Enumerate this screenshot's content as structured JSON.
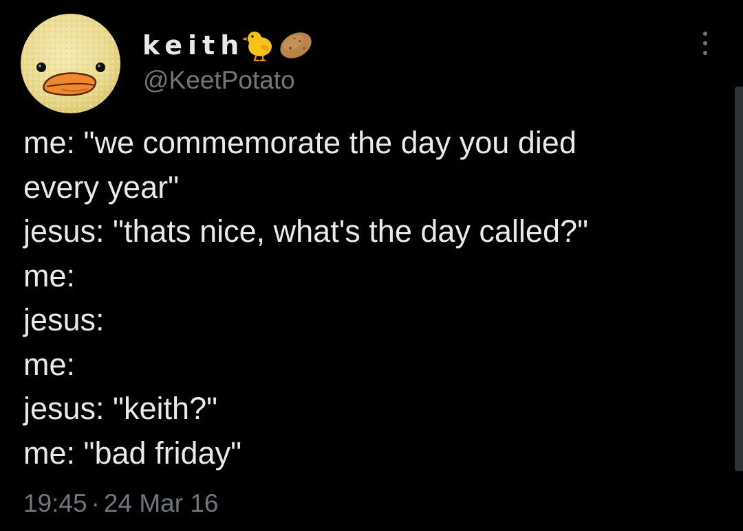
{
  "tweet": {
    "author": {
      "display_name": "keith",
      "display_name_emojis": [
        "chick-emoji",
        "potato-emoji"
      ],
      "handle": "@KeetPotato",
      "avatar": "duck-face-avatar"
    },
    "text_lines": [
      "me: \"we commemorate the day you died",
      "every year\"",
      "jesus: \"thats nice, what's the day called?\"",
      "me:",
      "jesus:",
      "me:",
      "jesus: \"keith?\"",
      "me: \"bad friday\""
    ],
    "time": "19:45",
    "separator": "·",
    "date": "24 Mar 16",
    "more_icon": "more-vertical-icon"
  },
  "colors": {
    "background": "#000000",
    "primary_text": "#e7e9ea",
    "secondary_text": "#71767b",
    "avatar_yellow": "#efe3a0",
    "beak_orange": "#f0882c"
  }
}
